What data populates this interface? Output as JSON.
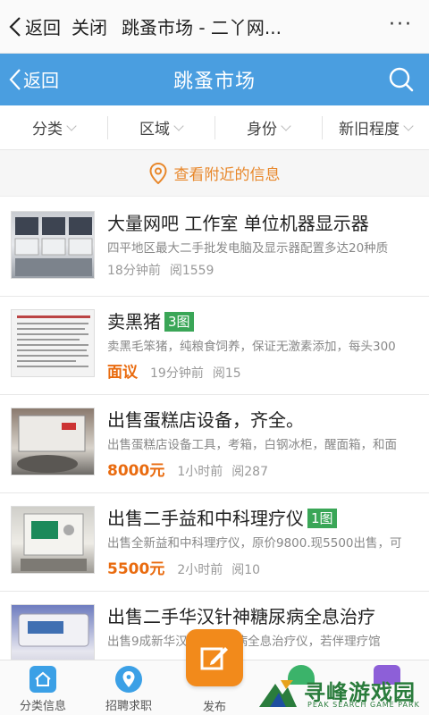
{
  "browser": {
    "back_label": "返回",
    "close_label": "关闭",
    "title": "跳蚤市场 - 二丫网...",
    "more": "···"
  },
  "app_header": {
    "back_label": "返回",
    "title": "跳蚤市场",
    "accent_color": "#4a9ee0"
  },
  "filters": [
    {
      "label": "分类"
    },
    {
      "label": "区域"
    },
    {
      "label": "身份"
    },
    {
      "label": "新旧程度"
    }
  ],
  "nearby": {
    "label": "查看附近的信息"
  },
  "listings": [
    {
      "title": "大量网吧 工作室 单位机器显示器",
      "tag": "",
      "desc": "四平地区最大二手批发电脑及显示器配置多达20种质",
      "price": "",
      "time": "18分钟前",
      "views": "阅1559"
    },
    {
      "title": "卖黑猪",
      "tag": "3图",
      "desc": "卖黑毛笨猪，纯粮食饲养，保证无激素添加，每头300",
      "price": "面议",
      "time": "19分钟前",
      "views": "阅15"
    },
    {
      "title": "出售蛋糕店设备，齐全。",
      "tag": "",
      "desc": "出售蛋糕店设备工具，考箱，白钢冰柜，醒面箱，和面",
      "price": "8000元",
      "time": "1小时前",
      "views": "阅287"
    },
    {
      "title": "出售二手益和中科理疗仪",
      "tag": "1图",
      "desc": "出售全新益和中科理疗仪，原价9800.现5500出售，可",
      "price": "5500元",
      "time": "2小时前",
      "views": "阅10"
    },
    {
      "title": "出售二手华汉针神糖尿病全息治疗",
      "tag": "",
      "desc": "出售9成新华汉针神糖尿病全息治疗仪，若伴理疗馆",
      "price": "",
      "time": "",
      "views": ""
    }
  ],
  "bottom_nav": {
    "items": [
      {
        "label": "分类信息",
        "icon": "home-icon"
      },
      {
        "label": "招聘求职",
        "icon": "location-pin-icon"
      }
    ],
    "publish_label": "发布"
  },
  "watermark": {
    "text": "寻峰游戏园",
    "sub": "PEAK SEARCH GAME PARK"
  }
}
